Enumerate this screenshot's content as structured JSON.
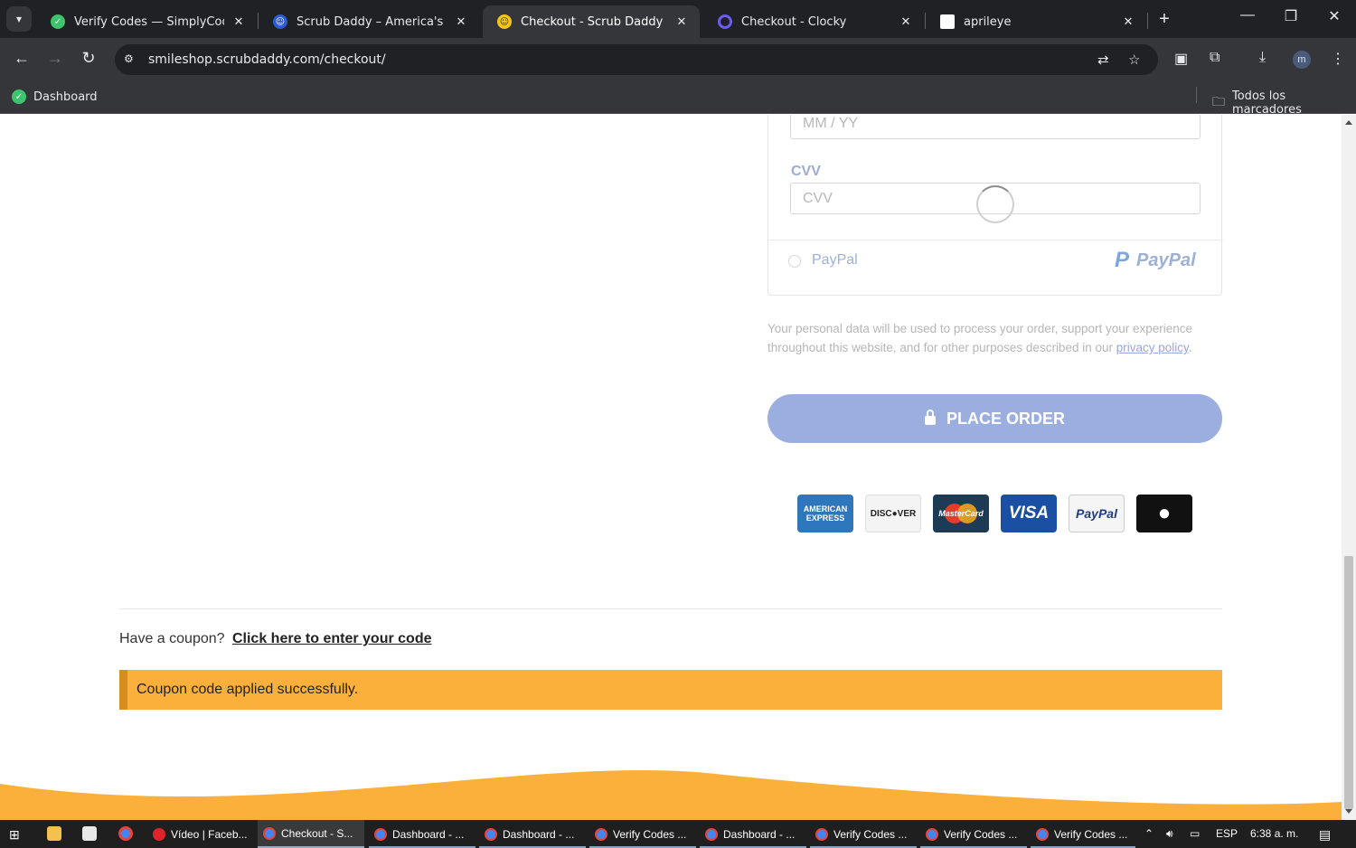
{
  "browser": {
    "tabs": [
      {
        "label": "Verify Codes — SimplyCodes",
        "active": false,
        "favicon_color": "#3ec46d"
      },
      {
        "label": "Scrub Daddy – America's Favori",
        "active": false,
        "favicon_color": "#f5c518"
      },
      {
        "label": "Checkout - Scrub Daddy Smile",
        "active": true,
        "favicon_color": "#f5c518"
      },
      {
        "label": "Checkout - Clocky",
        "active": false,
        "favicon_color": "#6a5cf0"
      },
      {
        "label": "aprileye",
        "active": false,
        "favicon_color": "#ffffff"
      }
    ],
    "new_tab_label": "+",
    "url": "smileshop.scrubdaddy.com/checkout/",
    "bookmarks": [
      {
        "label": "Dashboard"
      }
    ],
    "all_bookmarks_label": "Todos los marcadores",
    "profile_initial": "m"
  },
  "payment": {
    "expiry_placeholder": "MM / YY",
    "cvv_label": "CVV",
    "cvv_placeholder": "CVV",
    "paypal_option_label": "PayPal",
    "paypal_logo_text": "PayPal"
  },
  "privacy": {
    "text": "Your personal data will be used to process your order, support your experience throughout this website, and for other purposes described in our",
    "link": "privacy policy",
    "end": "."
  },
  "place_order_label": "PLACE ORDER",
  "cards": [
    {
      "name": "American Express",
      "line1": "AMERICAN",
      "line2": "EXPRESS"
    },
    {
      "name": "Discover",
      "text": "DISC●VER"
    },
    {
      "name": "Mastercard",
      "text": "MasterCard"
    },
    {
      "name": "Visa",
      "text": "VISA"
    },
    {
      "name": "PayPal",
      "text": "PayPal"
    },
    {
      "name": "Apple Pay",
      "text": ""
    }
  ],
  "coupon": {
    "prompt": "Have a coupon?",
    "link": "Click here to enter your code",
    "notice": "Coupon code applied successfully."
  },
  "taskbar": {
    "apps": [
      {
        "label": "Vídeo | Faceb...",
        "color": "#e0242a"
      },
      {
        "label": "Checkout - S...",
        "color": "#4285f4"
      },
      {
        "label": "Dashboard - ...",
        "color": "#4285f4"
      },
      {
        "label": "Dashboard - ...",
        "color": "#4285f4"
      },
      {
        "label": "Verify Codes ...",
        "color": "#4285f4"
      },
      {
        "label": "Dashboard - ...",
        "color": "#4285f4"
      },
      {
        "label": "Verify Codes ...",
        "color": "#4285f4"
      },
      {
        "label": "Verify Codes ...",
        "color": "#4285f4"
      },
      {
        "label": "Verify Codes ...",
        "color": "#4285f4"
      }
    ],
    "lang": "ESP",
    "time": "6:38 a. m."
  }
}
